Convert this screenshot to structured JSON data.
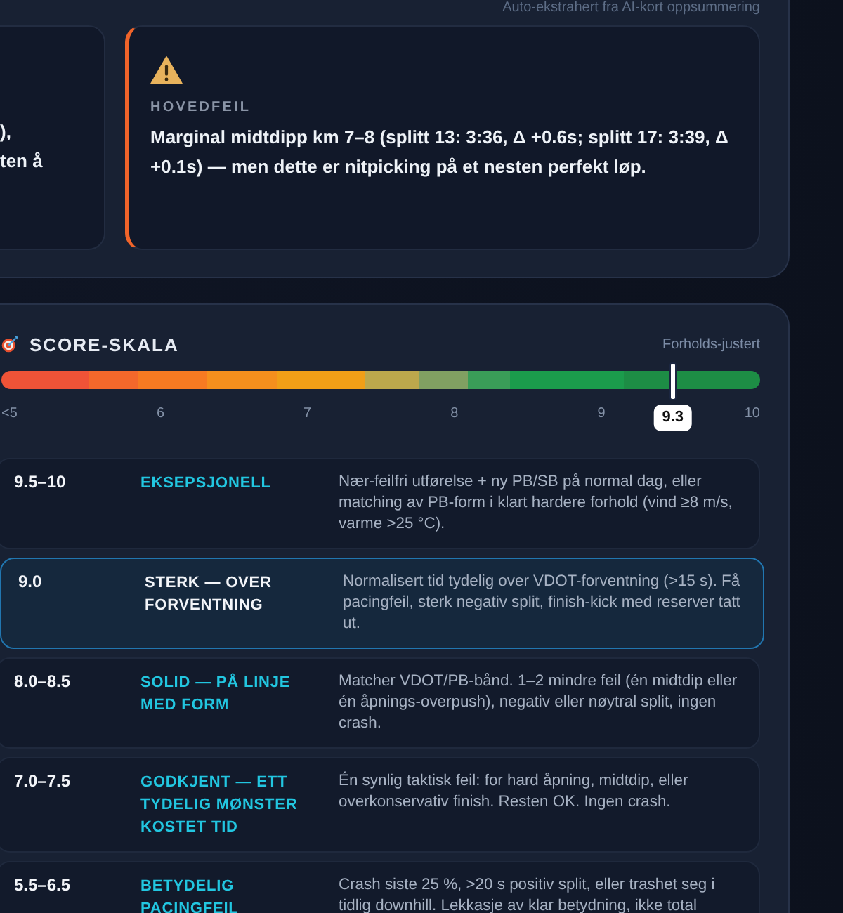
{
  "summary_panel": {
    "subtitle": "Auto-ekstrahert fra AI-kort oppsummering",
    "cards": [
      {
        "kind": "text",
        "text": "),\nten å"
      },
      {
        "kind": "warning",
        "label": "HOVEDFEIL",
        "text": "Marginal midtdipp km 7–8 (splitt 13: 3:36, Δ +0.6s; splitt 17: 3:39, Δ +0.1s) — men dette er nitpicking på et nesten perfekt løp."
      }
    ]
  },
  "score_scale": {
    "title": "SCORE-SKALA",
    "note": "Forholds-justert",
    "ticks": [
      "<5",
      "6",
      "7",
      "8",
      "9",
      "10"
    ],
    "marker": {
      "level": 0.885,
      "reading": "9.3"
    },
    "rows": [
      {
        "range": "9.5–10",
        "label": "EKSEPSJONELL",
        "description": "Nær-feilfri utførelse + ny PB/SB på normal dag, eller matching av PB-form i klart hardere forhold (vind ≥8 m/s, varme >25 °C).",
        "selected": false
      },
      {
        "range": "9.0",
        "label": "STERK — OVER FORVENTNING",
        "description": "Normalisert tid tydelig over VDOT-forventning (>15 s). Få pacingfeil, sterk negativ split, finish-kick med reserver tatt ut.",
        "selected": true
      },
      {
        "range": "8.0–8.5",
        "label": "SOLID — PÅ LINJE MED FORM",
        "description": "Matcher VDOT/PB-bånd. 1–2 mindre feil (én midtdip eller én åpnings-overpush), negativ eller nøytral split, ingen crash.",
        "selected": false
      },
      {
        "range": "7.0–7.5",
        "label": "GODKJENT — ETT TYDELIG MØNSTER KOSTET TID",
        "description": "Én synlig taktisk feil: for hard åpning, midtdip, eller overkonservativ finish. Resten OK. Ingen crash.",
        "selected": false
      },
      {
        "range": "5.5–6.5",
        "label": "BETYDELIG PACINGFEIL",
        "description": "Crash siste 25 %, >20 s positiv split, eller trashet seg i tidlig downhill. Lekkasje av klar betydning, ikke total",
        "selected": false
      }
    ]
  }
}
